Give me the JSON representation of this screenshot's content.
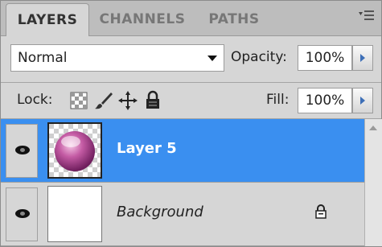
{
  "tabs": [
    {
      "label": "LAYERS",
      "active": true
    },
    {
      "label": "CHANNELS",
      "active": false
    },
    {
      "label": "PATHS",
      "active": false
    }
  ],
  "blend_mode": "Normal",
  "opacity": {
    "label": "Opacity:",
    "value": "100%"
  },
  "lock": {
    "label": "Lock:"
  },
  "fill": {
    "label": "Fill:",
    "value": "100%"
  },
  "layers": [
    {
      "name": "Layer 5",
      "selected": true,
      "visible": true
    },
    {
      "name": "Background",
      "selected": false,
      "visible": true,
      "locked": true
    }
  ],
  "colors": {
    "selection": "#3a8ff0",
    "panel": "#d6d6d6",
    "accent": "#3d6fb7"
  },
  "icons": [
    "panel-menu-icon",
    "dropdown-arrow-icon",
    "stepper-arrow-icon",
    "lock-transparency-icon",
    "lock-image-brush-icon",
    "lock-position-move-icon",
    "lock-all-icon",
    "eye-icon",
    "layer-lock-icon",
    "scroll-up-icon"
  ]
}
